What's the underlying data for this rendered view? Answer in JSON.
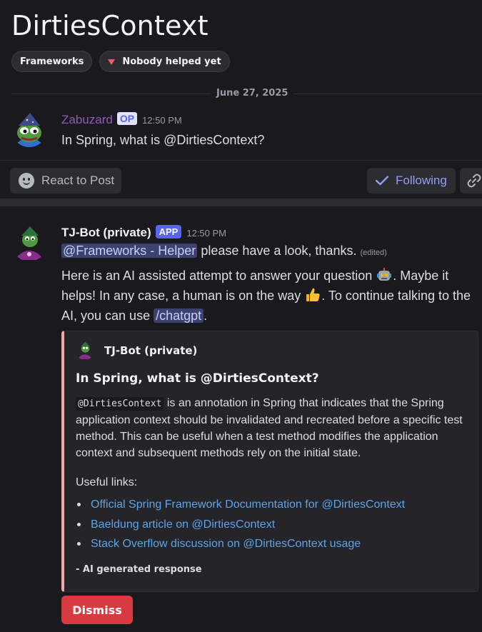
{
  "thread": {
    "title": "DirtiesContext",
    "tags": [
      "Frameworks",
      "Nobody helped yet"
    ],
    "date": "June 27, 2025"
  },
  "op_message": {
    "author": "Zabuzard",
    "badge": "OP",
    "time": "12:50 PM",
    "text": "In Spring, what is @DirtiesContext?"
  },
  "actions": {
    "react": "React to Post",
    "following": "Following"
  },
  "bot_message": {
    "author": "TJ-Bot (private)",
    "badge": "APP",
    "time": "12:50 PM",
    "mention": "@Frameworks - Helper",
    "mention_suffix": " please have a look, thanks.",
    "edited": "(edited)",
    "para_part1": "Here is an AI assisted attempt to answer your question ",
    "para_part2": ". Maybe it helps! In any case, a human is on the way ",
    "para_part3": ". To continue talking to the AI, you can use ",
    "slash_command": "/chatgpt",
    "para_end": "."
  },
  "embed": {
    "author": "TJ-Bot (private)",
    "title": "In Spring, what is @DirtiesContext?",
    "code": "@DirtiesContext",
    "description": " is an annotation in Spring that indicates that the Spring application context should be invalidated and recreated before a specific test method. This can be useful when a test method modifies the application context and subsequent methods rely on the initial state.",
    "useful_links_label": "Useful links:",
    "links": [
      "Official Spring Framework Documentation for @DirtiesContext",
      "Baeldung article on @DirtiesContext",
      "Stack Overflow discussion on @DirtiesContext usage"
    ],
    "footer": "- AI generated response",
    "accent_color": "#f3a7ad"
  },
  "dismiss_label": "Dismiss",
  "colors": {
    "background": "#1a1a1e",
    "op_name": "#8e5bb5",
    "bot_name": "#f2f3f5",
    "link": "#5ba4ea",
    "dismiss": "#d83a42",
    "brand": "#5865f2"
  }
}
